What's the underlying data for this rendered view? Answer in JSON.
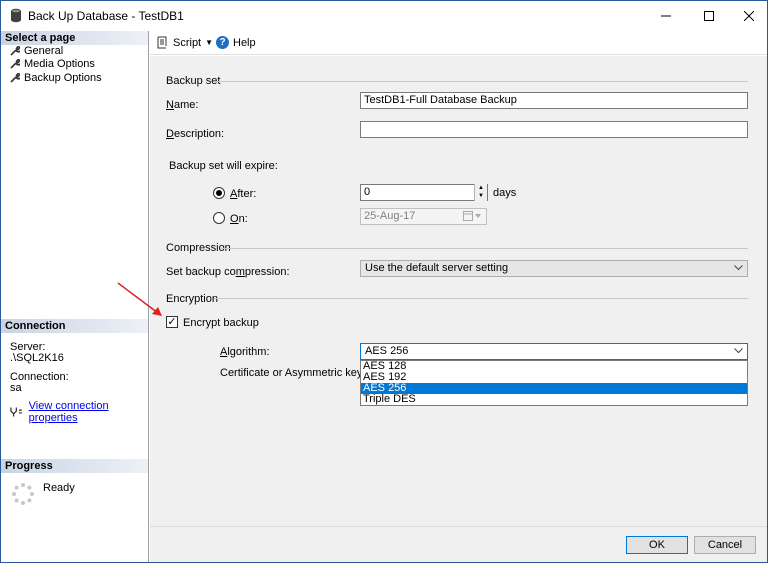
{
  "window": {
    "title": "Back Up Database - TestDB1"
  },
  "left_panel": {
    "select_page_header": "Select a page",
    "pages": [
      {
        "label": "General"
      },
      {
        "label": "Media Options"
      },
      {
        "label": "Backup Options"
      }
    ],
    "connection_header": "Connection",
    "server_label": "Server:",
    "server_value": ".\\SQL2K16",
    "connection_label": "Connection:",
    "connection_value": "sa",
    "view_properties_link": "View connection properties",
    "progress_header": "Progress",
    "progress_status": "Ready"
  },
  "toolbar": {
    "script_label": "Script",
    "help_label": "Help"
  },
  "backup_set": {
    "group_title": "Backup set",
    "name_label": "Name:",
    "name_value": "TestDB1-Full Database Backup",
    "description_label": "Description:",
    "description_value": "",
    "expire_label": "Backup set will expire:",
    "after_label": "After:",
    "after_value": "0",
    "days_label": "days",
    "on_label": "On:",
    "on_value": "25-Aug-17",
    "selected_expire": "after"
  },
  "compression": {
    "group_title": "Compression",
    "set_label": "Set backup compression:",
    "selected": "Use the default server setting"
  },
  "encryption": {
    "group_title": "Encryption",
    "encrypt_label": "Encrypt backup",
    "encrypt_checked": true,
    "algorithm_label": "Algorithm:",
    "algorithm_selected": "AES 256",
    "certificate_label": "Certificate or Asymmetric key:",
    "algorithm_options": [
      "AES 128",
      "AES 192",
      "AES 256",
      "Triple DES"
    ]
  },
  "buttons": {
    "ok": "OK",
    "cancel": "Cancel"
  },
  "colors": {
    "accent": "#0078d7",
    "annotation_arrow": "#e02020",
    "link": "#0000ee"
  }
}
